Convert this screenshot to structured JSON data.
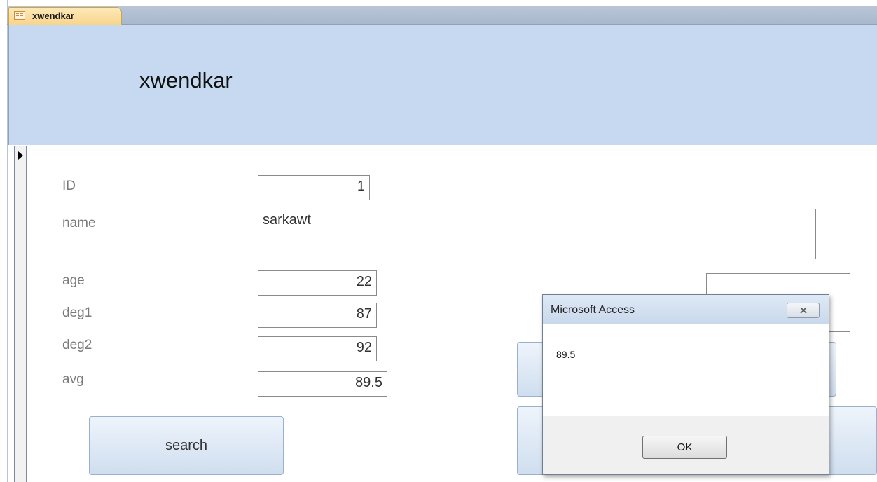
{
  "tab": {
    "label": "xwendkar",
    "icon": "form-icon"
  },
  "header": {
    "title": "xwendkar"
  },
  "record_selector": {
    "icon": "current-record-arrow-icon"
  },
  "fields": {
    "id": {
      "label": "ID",
      "value": "1"
    },
    "name": {
      "label": "name",
      "value": "sarkawt"
    },
    "age": {
      "label": "age",
      "value": "22"
    },
    "deg1": {
      "label": "deg1",
      "value": "87"
    },
    "deg2": {
      "label": "deg2",
      "value": "92"
    },
    "avg": {
      "label": "avg",
      "value": "89.5"
    }
  },
  "buttons": {
    "search": "search"
  },
  "dialog": {
    "title": "Microsoft Access",
    "close_icon": "close-icon",
    "message": "89.5",
    "ok_label": "OK"
  },
  "colors": {
    "header_bg": "#c6d9f1",
    "tab_bg": "#f8d58c",
    "button_bg": "#cfdeef"
  }
}
